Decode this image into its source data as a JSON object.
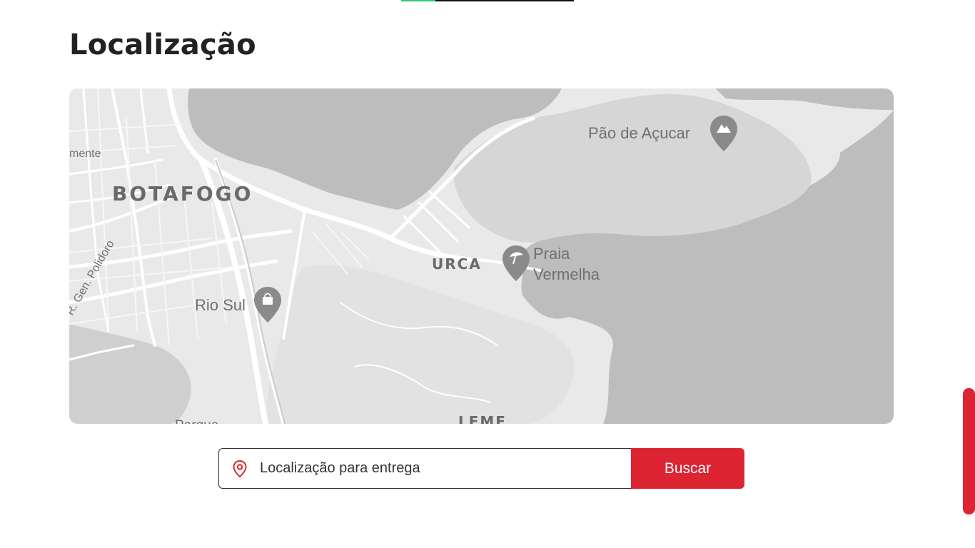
{
  "page": {
    "title": "Localização"
  },
  "loading_bar": {
    "progress": 0.2,
    "track_color": "#111111",
    "fill_color": "#2ecc71"
  },
  "map": {
    "style": "grayscale",
    "labels": {
      "neighborhood_botafogo": "BOTAFOGO",
      "neighborhood_urca": "URCA",
      "neighborhood_leme": "LEME",
      "street_polidoro": "R. Gen. Polidoro",
      "street_clemente": "mente",
      "park_partial": "Parque"
    },
    "pois": [
      {
        "name": "Pão de Açucar",
        "icon": "mountain-icon"
      },
      {
        "name_line1": "Praia",
        "name_line2": "Vermelha",
        "icon": "beach-umbrella-icon"
      },
      {
        "name": "Rio Sul",
        "icon": "shopping-bag-icon"
      }
    ],
    "colors": {
      "water": "#bdbdbd",
      "land": "#e9e9e9",
      "hills": "#d6d6d6",
      "roads": "#ffffff"
    }
  },
  "search": {
    "placeholder": "Localização para entrega",
    "button_label": "Buscar",
    "icon": "map-pin-icon",
    "accent_color": "#dc2433"
  },
  "scrollbar": {
    "color": "#dc2433"
  }
}
